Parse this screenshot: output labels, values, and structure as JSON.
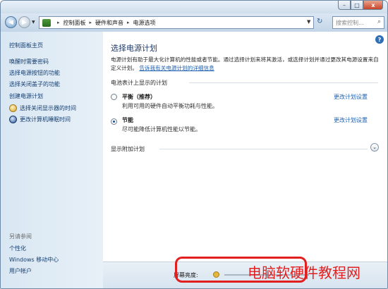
{
  "window": {
    "caption_minimize": "–",
    "caption_maximize": "□",
    "caption_close": "x"
  },
  "address_bar": {
    "crumbs": [
      "控制面板",
      "硬件和声音",
      "电源选项"
    ],
    "search_placeholder": "搜索控制...",
    "refresh_symbol": "↻"
  },
  "sidebar": {
    "home": "控制面板主页",
    "items": [
      "唤醒时需要密码",
      "选择电源按钮的功能",
      "选择关闭盖子的功能",
      "创建电源计划",
      "选择关闭显示器的时间",
      "更改计算机睡眠时间"
    ],
    "see_also_title": "另请参阅",
    "see_also": [
      "个性化",
      "Windows 移动中心",
      "用户帐户"
    ]
  },
  "main": {
    "help_symbol": "?",
    "title": "选择电源计划",
    "description": "电源计划有助于最大化计算机的性能或者节能。通过选择计划来将其激活，或选择计划并通过更改其电源设置来自定义计划。",
    "description_link": "告诉我有关电源计划的详细信息",
    "section_label": "电池表计上显示的计划",
    "plans": [
      {
        "name": "平衡（推荐）",
        "description": "利用可用的硬件自动平衡功耗与性能。",
        "link": "更改计划设置",
        "selected": false
      },
      {
        "name": "节能",
        "description": "尽可能降低计算机性能以节能。",
        "link": "更改计划设置",
        "selected": true
      }
    ],
    "extra_plans_label": "显示附加计划",
    "expand_symbol": "⌄"
  },
  "bottom": {
    "brightness_label": "屏幕亮度:"
  },
  "watermark": "电脑软硬件教程网",
  "colors": {
    "link": "#1d5fb0",
    "highlight": "#e11f1f"
  }
}
